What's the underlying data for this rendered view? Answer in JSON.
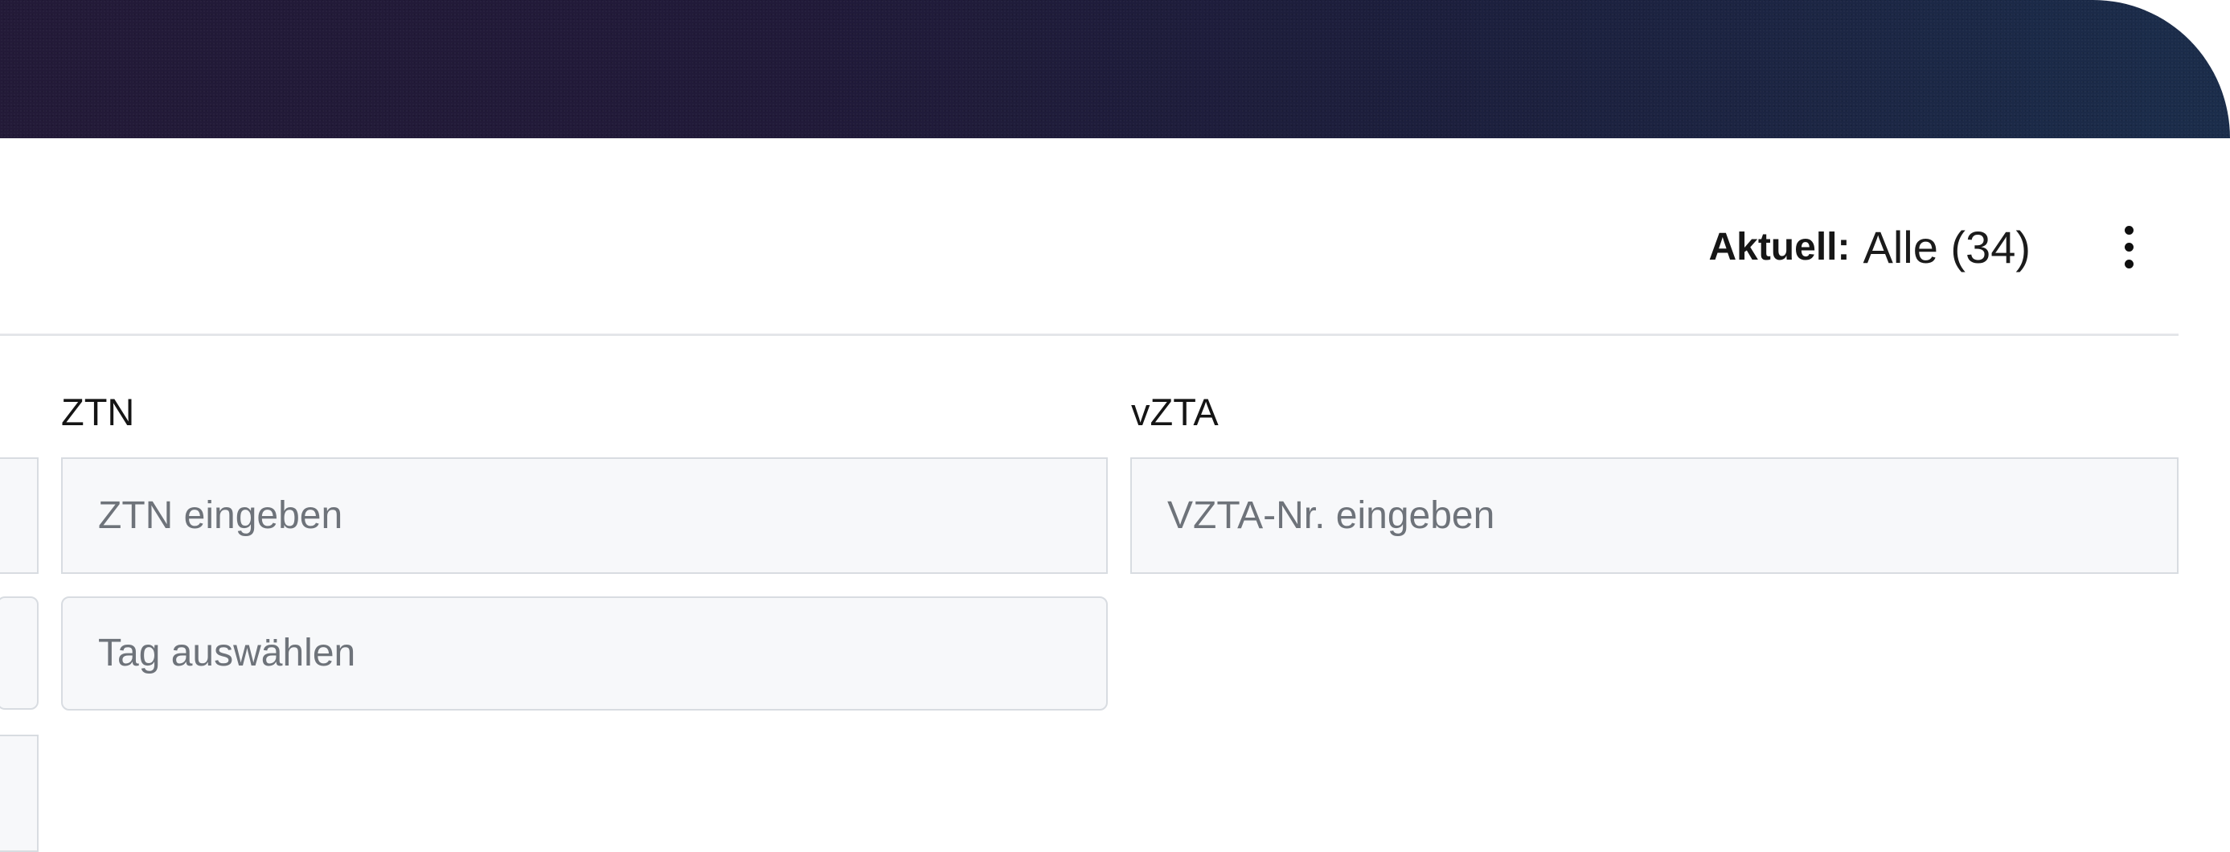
{
  "status": {
    "label": "Aktuell:",
    "value": "Alle (34)"
  },
  "actions": {
    "more_icon": "more-vertical-icon"
  },
  "filters": {
    "ztn": {
      "label": "ZTN",
      "placeholder": "ZTN eingeben"
    },
    "vzta": {
      "label": "vZTA",
      "placeholder": "VZTA-Nr. eingeben"
    },
    "tag": {
      "placeholder": "Tag auswählen"
    }
  },
  "colors": {
    "header_gradient_start": "#231a38",
    "header_gradient_end": "#1b2d4b",
    "input_background": "#f7f8fa",
    "input_border": "#d8dce1",
    "placeholder_text": "#6e737a"
  }
}
